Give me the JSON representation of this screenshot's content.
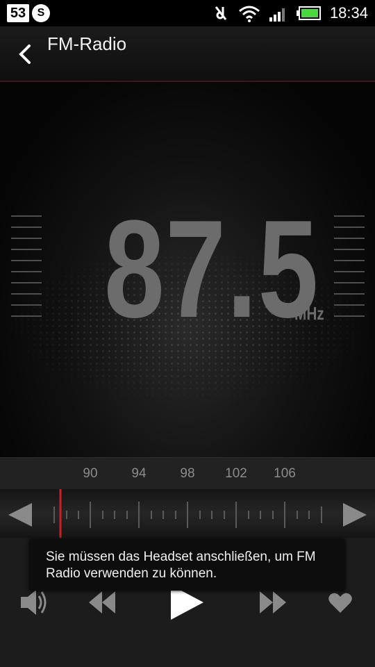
{
  "status_bar": {
    "notification_count": "53",
    "time": "18:34"
  },
  "app_bar": {
    "title": "FM-Radio"
  },
  "tuner_display": {
    "frequency": "87.5",
    "unit": "MHz"
  },
  "scale": {
    "labels": [
      "90",
      "94",
      "98",
      "102",
      "106"
    ]
  },
  "toast": {
    "message": "Sie müssen das Headset anschließen, um FM Radio verwenden zu können."
  },
  "icons": {
    "back": "back-arrow-icon",
    "prev": "triangle-left-icon",
    "next": "triangle-right-icon",
    "volume": "speaker-icon",
    "rewind": "rewind-icon",
    "play": "play-icon",
    "forward": "fast-forward-icon",
    "favorite": "heart-icon"
  },
  "colors": {
    "needle": "#cc1f1f",
    "frequency_text": "#6c6c6c"
  }
}
